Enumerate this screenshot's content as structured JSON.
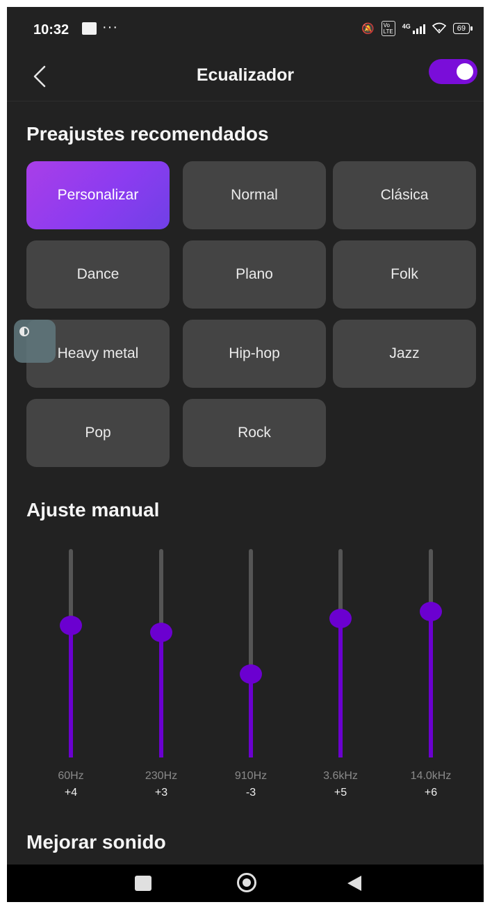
{
  "status_bar": {
    "time": "10:32",
    "more": "···",
    "network": "4G",
    "battery": "69",
    "icons": [
      "screen-record-icon",
      "mute-icon",
      "volte-icon",
      "signal-icon",
      "wifi-icon",
      "battery-icon"
    ]
  },
  "header": {
    "title": "Ecualizador",
    "back_icon": "chevron-left-icon",
    "toggle_on": true,
    "accent_color": "#7a0dd9"
  },
  "presets": {
    "section_title": "Preajustes recomendados",
    "items": [
      {
        "label": "Personalizar",
        "selected": true
      },
      {
        "label": "Normal",
        "selected": false
      },
      {
        "label": "Clásica",
        "selected": false
      },
      {
        "label": "Dance",
        "selected": false
      },
      {
        "label": "Plano",
        "selected": false
      },
      {
        "label": "Folk",
        "selected": false
      },
      {
        "label": "Heavy metal",
        "selected": false
      },
      {
        "label": "Hip-hop",
        "selected": false
      },
      {
        "label": "Jazz",
        "selected": false
      },
      {
        "label": "Pop",
        "selected": false
      },
      {
        "label": "Rock",
        "selected": false
      }
    ]
  },
  "manual": {
    "section_title": "Ajuste manual",
    "bands": [
      {
        "freq": "60Hz",
        "value": "+4",
        "level": 4
      },
      {
        "freq": "230Hz",
        "value": "+3",
        "level": 3
      },
      {
        "freq": "910Hz",
        "value": "-3",
        "level": -3
      },
      {
        "freq": "3.6kHz",
        "value": "+5",
        "level": 5
      },
      {
        "freq": "14.0kHz",
        "value": "+6",
        "level": 6
      }
    ],
    "level_range": [
      -15,
      15
    ],
    "color": "#6b00d0"
  },
  "enhance": {
    "section_title": "Mejorar sonido"
  },
  "nav_bar": {
    "icons": [
      "recent-apps-icon",
      "home-icon",
      "back-icon"
    ]
  }
}
